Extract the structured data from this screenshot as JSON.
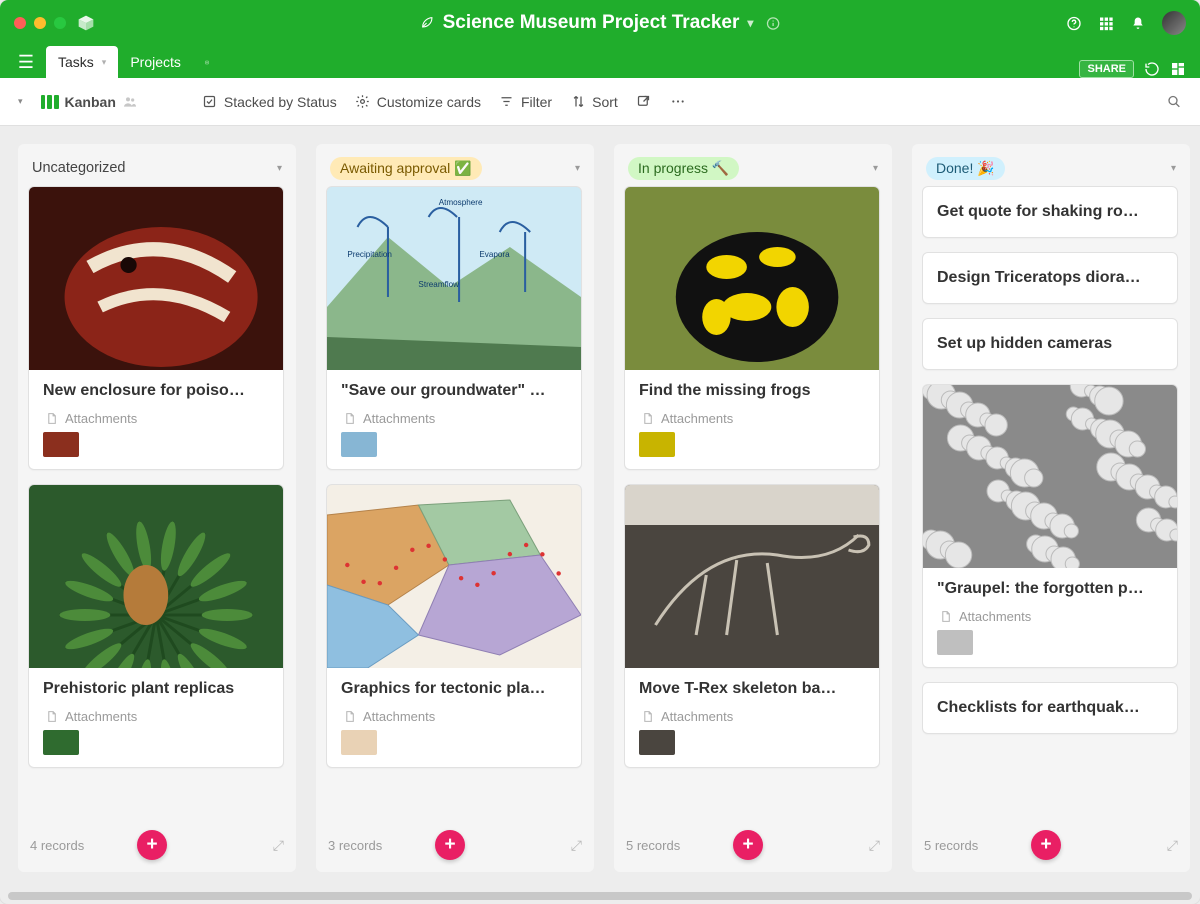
{
  "window_title": "Science Museum Project Tracker",
  "tabs": [
    {
      "label": "Tasks",
      "active": true
    },
    {
      "label": "Projects",
      "active": false
    }
  ],
  "share_label": "SHARE",
  "toolbar": {
    "view_name": "Kanban",
    "stacked_by": "Stacked by Status",
    "customize": "Customize cards",
    "filter": "Filter",
    "sort": "Sort"
  },
  "columns": [
    {
      "title": "Uncategorized",
      "pill_class": "",
      "records_label": "4 records",
      "cards": [
        {
          "title": "New enclosure for poiso…",
          "attach_label": "Attachments",
          "has_cover": true,
          "cover_color": "#8b2f1e"
        },
        {
          "title": "Prehistoric plant replicas",
          "attach_label": "Attachments",
          "has_cover": true,
          "cover_color": "#2f6b2f"
        }
      ]
    },
    {
      "title": "Awaiting approval ✅",
      "pill_class": "pill-yellow",
      "records_label": "3 records",
      "cards": [
        {
          "title": "\"Save our groundwater\" …",
          "attach_label": "Attachments",
          "has_cover": true,
          "cover_color": "#87b6d4"
        },
        {
          "title": "Graphics for tectonic pla…",
          "attach_label": "Attachments",
          "has_cover": true,
          "cover_color": "#e9d2b5"
        }
      ]
    },
    {
      "title": "In progress 🔨",
      "pill_class": "pill-green",
      "records_label": "5 records",
      "cards": [
        {
          "title": "Find the missing frogs",
          "attach_label": "Attachments",
          "has_cover": true,
          "cover_color": "#c8b400"
        },
        {
          "title": "Move T-Rex skeleton ba…",
          "attach_label": "Attachments",
          "has_cover": true,
          "cover_color": "#4a453f"
        }
      ]
    },
    {
      "title": "Done! 🎉",
      "pill_class": "pill-blue",
      "records_label": "5 records",
      "cards": [
        {
          "title": "Get quote for shaking ro…",
          "simple": true
        },
        {
          "title": "Design Triceratops diora…",
          "simple": true
        },
        {
          "title": "Set up hidden cameras",
          "simple": true
        },
        {
          "title": "\"Graupel: the forgotten p…",
          "attach_label": "Attachments",
          "has_cover": true,
          "cover_color": "#bfbfbf"
        },
        {
          "title": "Checklists for earthquak…",
          "simple": true
        }
      ]
    }
  ]
}
